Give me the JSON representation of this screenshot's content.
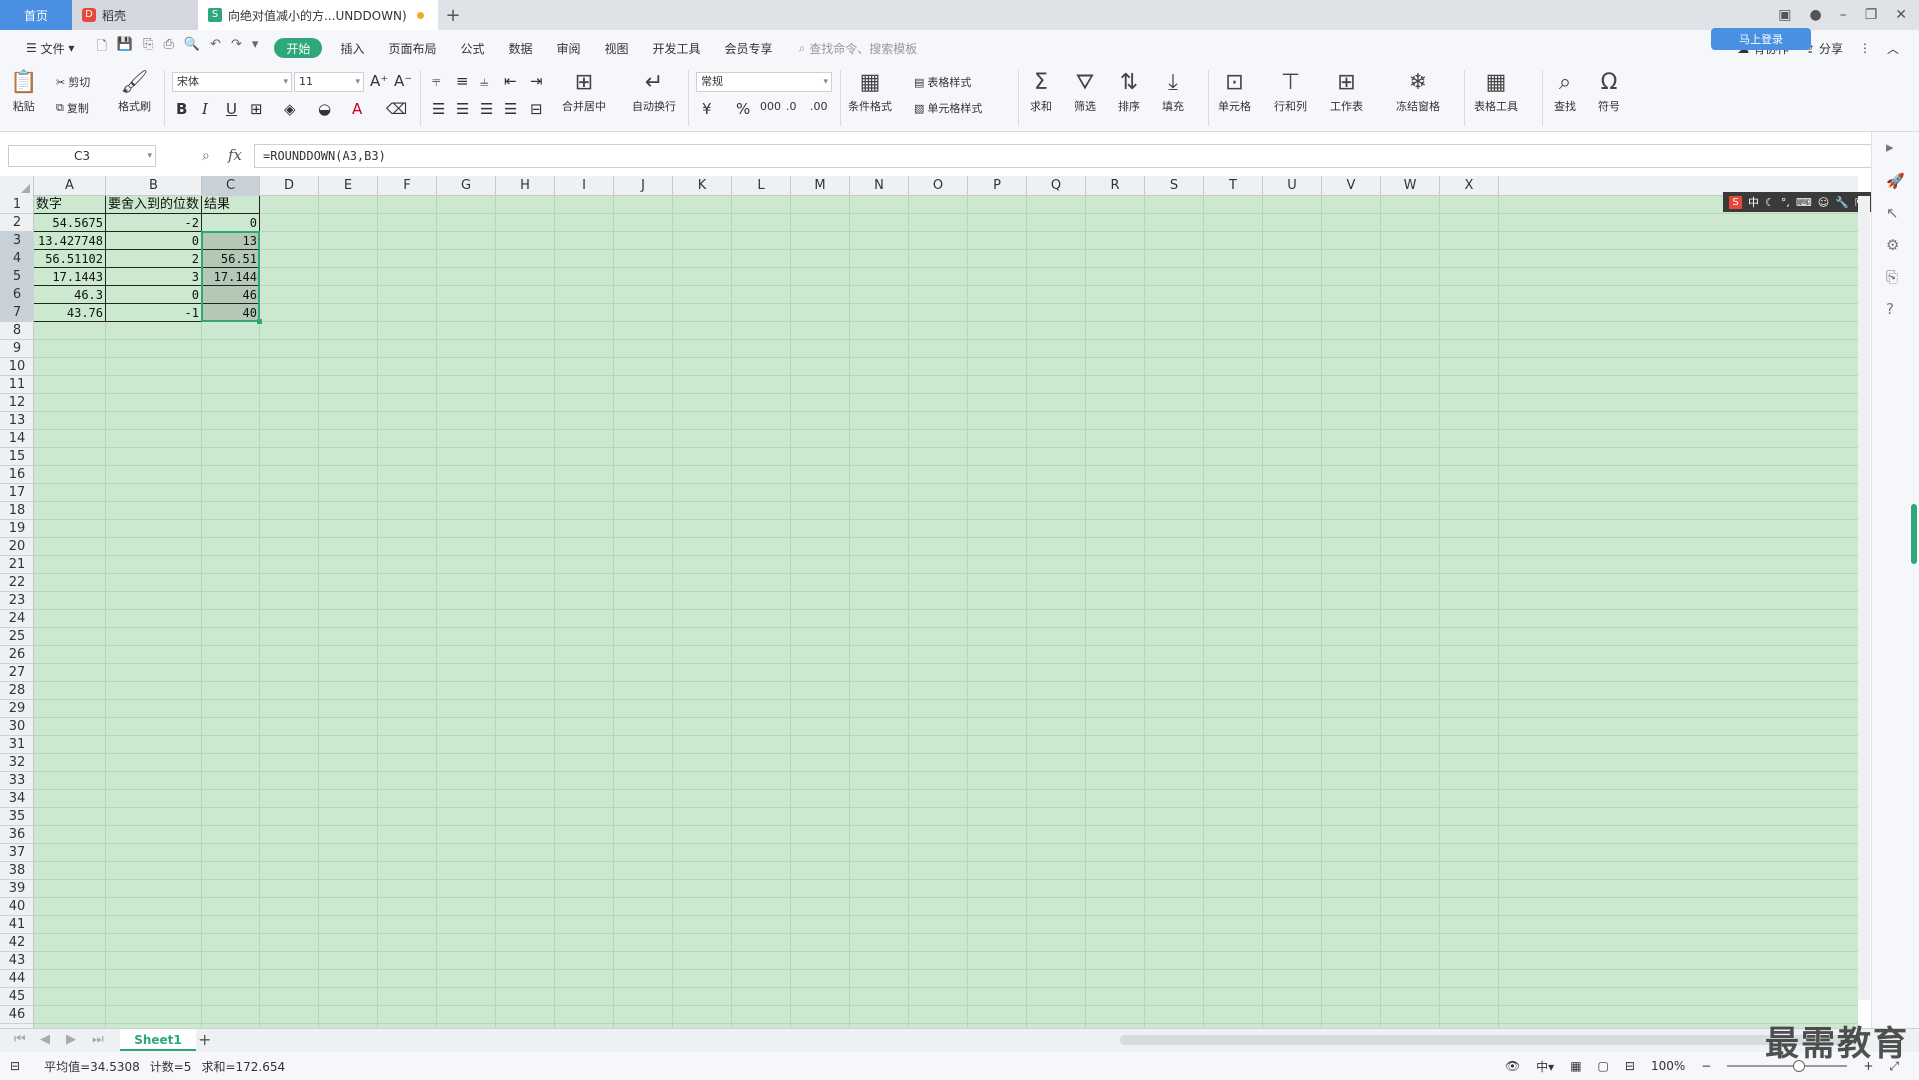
{
  "tabs": {
    "home": "首页",
    "wps": "稻壳",
    "doc": "向绝对值减小的方...UNDDOWN)"
  },
  "menu": {
    "file": "文件",
    "items": [
      "开始",
      "插入",
      "页面布局",
      "公式",
      "数据",
      "审阅",
      "视图",
      "开发工具",
      "会员专享"
    ],
    "search_placeholder": "查找命令、搜索模板",
    "collab": "有协作",
    "share": "分享",
    "cloud": "马上登录"
  },
  "ribbon": {
    "paste": "粘贴",
    "cut": "剪切",
    "copy": "复制",
    "format_painter": "格式刷",
    "font_name": "宋体",
    "font_size": "11",
    "merge_center": "合并居中",
    "wrap": "自动换行",
    "number_format": "常规",
    "cond_format": "条件格式",
    "table_style": "表格样式",
    "cell_style": "单元格样式",
    "sum": "求和",
    "filter": "筛选",
    "sort": "排序",
    "fill": "填充",
    "cell": "单元格",
    "rowcol": "行和列",
    "worksheet": "工作表",
    "freeze": "冻结窗格",
    "table_tools": "表格工具",
    "find": "查找",
    "symbol": "符号"
  },
  "formula_bar": {
    "name_box": "C3",
    "fx": "fx",
    "formula": "=ROUNDDOWN(A3,B3)"
  },
  "grid": {
    "columns": [
      "A",
      "B",
      "C",
      "D",
      "E",
      "F",
      "G",
      "H",
      "I",
      "J",
      "K",
      "L",
      "M",
      "N",
      "O",
      "P",
      "Q",
      "R",
      "S",
      "T",
      "U",
      "V",
      "W",
      "X"
    ],
    "rows": [
      "1",
      "2",
      "3",
      "4",
      "5",
      "6",
      "7",
      "8",
      "9",
      "10",
      "11",
      "12",
      "13",
      "14",
      "15",
      "16",
      "17",
      "18",
      "19",
      "20",
      "21",
      "22",
      "23",
      "24",
      "25",
      "26",
      "27",
      "28",
      "29",
      "30",
      "31",
      "32",
      "33",
      "34",
      "35",
      "36",
      "37",
      "38",
      "39",
      "40",
      "41",
      "42",
      "43",
      "44",
      "45",
      "46"
    ],
    "header": [
      "数字",
      "要舍入到的位数",
      "结果"
    ],
    "data": [
      [
        "54.5675",
        "-2",
        "0"
      ],
      [
        "13.427748",
        "0",
        "13"
      ],
      [
        "56.51102",
        "2",
        "56.51"
      ],
      [
        "17.1443",
        "3",
        "17.144"
      ],
      [
        "46.3",
        "0",
        "46"
      ],
      [
        "43.76",
        "-1",
        "40"
      ]
    ]
  },
  "ime": "中",
  "sheet_tab": "Sheet1",
  "status": {
    "average": "平均值=34.5308",
    "count": "计数=5",
    "sum": "求和=172.654",
    "zoom": "100%"
  },
  "watermark": "最需教育",
  "colors": {
    "accent": "#2ea77a",
    "sheet_bg": "#cce8cf",
    "home_tab": "#4a90e2"
  }
}
